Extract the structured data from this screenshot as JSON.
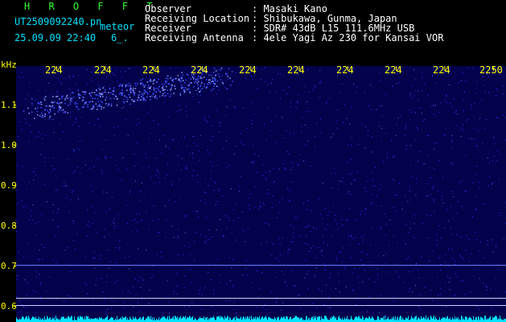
{
  "header": {
    "title": "H R O F F T",
    "filename": "UT2509092240.pn",
    "meteor_label": "meteor",
    "datetime": "25.09.09 22:40",
    "count": "6_.",
    "fields": [
      {
        "label": "Observer",
        "value": ": Masaki Kano"
      },
      {
        "label": "Receiving Location",
        "value": ": Shibukawa, Gunma, Japan"
      },
      {
        "label": "Receiver",
        "value": ": SDR# 43dB L15 111.6MHz USB"
      },
      {
        "label": "Receiving Antenna",
        "value": ": 4ele Yagi Az 230 for Kansai VOR"
      }
    ]
  },
  "spectrogram": {
    "y_unit": "kHz",
    "x_ticks": [
      "224",
      "224",
      "224",
      "224",
      "224",
      "224",
      "224",
      "224",
      "224",
      "2250"
    ],
    "y_ticks": [
      "1.1",
      "1.0",
      "0.9",
      "0.8",
      "0.7",
      "0.6"
    ],
    "colors": {
      "background": "#04014d",
      "signal": "#2a3cff",
      "baseline": "#00e5ff",
      "axis": "#ffff00"
    }
  }
}
